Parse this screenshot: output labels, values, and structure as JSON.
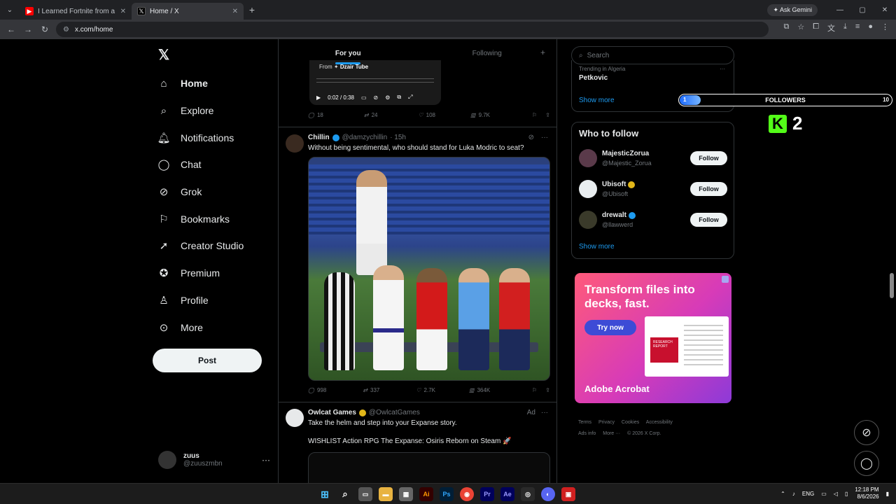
{
  "browser": {
    "tabs": [
      {
        "title": "I Learned Fortnite from a Pro G",
        "active": false
      },
      {
        "title": "Home / X",
        "active": true
      }
    ],
    "ask_gemini": "Ask Gemini",
    "url": "x.com/home"
  },
  "sidebar": {
    "items": [
      {
        "label": "Home",
        "icon": "home-icon"
      },
      {
        "label": "Explore",
        "icon": "search-icon"
      },
      {
        "label": "Notifications",
        "icon": "bell-icon"
      },
      {
        "label": "Chat",
        "icon": "chat-icon"
      },
      {
        "label": "Grok",
        "icon": "grok-icon"
      },
      {
        "label": "Bookmarks",
        "icon": "bookmark-icon"
      },
      {
        "label": "Creator Studio",
        "icon": "rocket-icon"
      },
      {
        "label": "Premium",
        "icon": "verified-icon"
      },
      {
        "label": "Profile",
        "icon": "person-icon"
      },
      {
        "label": "More",
        "icon": "more-circle-icon"
      }
    ],
    "post_label": "Post",
    "account": {
      "name": "zuus",
      "handle": "@zuuszmbn"
    }
  },
  "timeline": {
    "tabs": [
      "For you",
      "Following"
    ],
    "video": {
      "from_label": "From",
      "source": "Dzair Tube",
      "time": "0:02 / 0:38",
      "watermark": "www.dzair-tube.dz"
    },
    "post1_actions": {
      "replies": "18",
      "reposts": "24",
      "likes": "108",
      "views": "9.7K"
    },
    "post2": {
      "name": "Chillin",
      "handle": "@damzychillin",
      "time": "· 15h",
      "text": "Without being sentimental, who should stand for Luka Modric to seat?",
      "actions": {
        "replies": "998",
        "reposts": "337",
        "likes": "2.7K",
        "views": "364K"
      }
    },
    "post3": {
      "name": "Owlcat Games",
      "handle": "@OwlcatGames",
      "ad": "Ad",
      "text1": "Take the helm and step into your Expanse story.",
      "text2": "WISHLIST Action RPG The Expanse: Osiris Reborn on Steam 🚀"
    }
  },
  "right": {
    "search_placeholder": "Search",
    "trend": {
      "meta": "Trending in Algeria",
      "name": "Petkovic"
    },
    "show_more": "Show more",
    "who_to_follow": "Who to follow",
    "follow_label": "Follow",
    "suggestions": [
      {
        "name": "MajesticZorua",
        "handle": "@Majestic_Zorua",
        "verified": false
      },
      {
        "name": "Ubisoft",
        "handle": "@Ubisoft",
        "verified": true,
        "badge": "gold"
      },
      {
        "name": "drewalt",
        "handle": "@llawwerd",
        "verified": true,
        "badge": "blue"
      }
    ],
    "ad": {
      "headline": "Transform files into decks, fast.",
      "cta": "Try now",
      "brand": "Adobe Acrobat",
      "doc_label": "RESEARCH REPORT"
    },
    "footer": [
      "Terms",
      "Privacy",
      "Cookies",
      "Accessibility",
      "Ads info",
      "More ···",
      "© 2026 X Corp."
    ]
  },
  "overlay": {
    "followers_label": "FOLLOWERS",
    "followers_current": "1",
    "followers_goal": "10",
    "followers_fraction": 0.1,
    "kick_count": "2"
  },
  "taskbar": {
    "lang": "ENG",
    "time": "12:18 PM",
    "date": "8/6/2026"
  }
}
